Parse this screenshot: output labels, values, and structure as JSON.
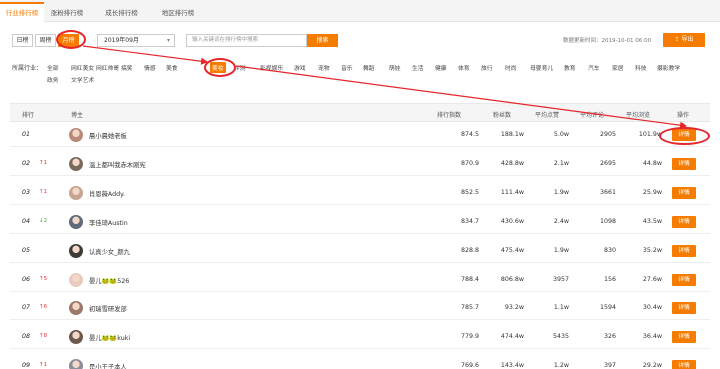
{
  "tabs": [
    {
      "label": "行业排行榜"
    },
    {
      "label": "涨粉排行榜"
    },
    {
      "label": "成长排行榜"
    },
    {
      "label": "地区排行榜"
    }
  ],
  "toolbar": {
    "period_day": "日榜",
    "period_week": "周榜",
    "period_month": "月榜",
    "month_value": "2019年09月",
    "search_placeholder": "输入关键词在排行榜中搜索",
    "search_label": "搜索",
    "update_time": "数据更新时间：2019-10-01 06:00",
    "export_label": "导出"
  },
  "industry": {
    "label": "所属行业：",
    "items": [
      "全部",
      "网红美女",
      "网红帅哥",
      "搞笑",
      "情感",
      "美食",
      "美妆",
      "评测",
      "影视娱乐",
      "游戏",
      "宠物",
      "音乐",
      "舞蹈",
      "萌娃",
      "生活",
      "健康",
      "体育",
      "旅行",
      "时尚",
      "母婴育儿",
      "教育",
      "汽车",
      "家居",
      "科技",
      "摄影教学",
      "政务",
      "文学艺术"
    ],
    "active_index": 6
  },
  "table": {
    "headers": {
      "rank": "排行",
      "name": "博主",
      "index": "排行指数",
      "fans": "粉丝数",
      "avg_likes": "平均点赞",
      "avg_comments": "平均评论",
      "avg_views": "平均浏览",
      "ops": "操作"
    },
    "detail_label": "详情",
    "rows": [
      {
        "rank": "01",
        "trend": "",
        "trend_color": "#999999",
        "name": "晨小晨她老板",
        "index": "874.5",
        "fans": "188.1w",
        "likes": "5.0w",
        "comments": "2905",
        "views": "101.9w",
        "avatar_color": "#b98a7a"
      },
      {
        "rank": "02",
        "trend": "↑1",
        "trend_color": "#e53935",
        "name": "温上都叫我赤木刚宪",
        "index": "870.9",
        "fans": "428.8w",
        "likes": "2.1w",
        "comments": "2695",
        "views": "44.8w",
        "avatar_color": "#7a6a5e"
      },
      {
        "rank": "03",
        "trend": "↑1",
        "trend_color": "#e53935",
        "name": "肖恩薇Addy.",
        "index": "852.5",
        "fans": "111.4w",
        "likes": "1.9w",
        "comments": "3661",
        "views": "25.9w",
        "avatar_color": "#c7a48f"
      },
      {
        "rank": "04",
        "trend": "↓2",
        "trend_color": "#43a047",
        "name": "李佳琦Austin",
        "index": "834.7",
        "fans": "430.6w",
        "likes": "2.4w",
        "comments": "1098",
        "views": "43.5w",
        "avatar_color": "#5d6b7a"
      },
      {
        "rank": "05",
        "trend": "",
        "trend_color": "#999999",
        "name": "认真少女_颜九",
        "index": "828.8",
        "fans": "475.4w",
        "likes": "1.9w",
        "comments": "830",
        "views": "35.2w",
        "avatar_color": "#3f3a36"
      },
      {
        "rank": "06",
        "trend": "↑5",
        "trend_color": "#e53935",
        "name": "晏儿🐸🐸526",
        "index": "788.4",
        "fans": "806.8w",
        "likes": "3957",
        "comments": "156",
        "views": "27.6w",
        "avatar_color": "#e8cbc0"
      },
      {
        "rank": "07",
        "trend": "↑6",
        "trend_color": "#e53935",
        "name": "初瑞雪研发部",
        "index": "785.7",
        "fans": "93.2w",
        "likes": "1.1w",
        "comments": "1594",
        "views": "30.4w",
        "avatar_color": "#9c7b6b"
      },
      {
        "rank": "08",
        "trend": "↑8",
        "trend_color": "#e53935",
        "name": "晏儿🐸🐸kuki",
        "index": "779.9",
        "fans": "474.4w",
        "likes": "5435",
        "comments": "326",
        "views": "36.4w",
        "avatar_color": "#6e5a4d"
      },
      {
        "rank": "09",
        "trend": "↑1",
        "trend_color": "#e53935",
        "name": "是小王子本人",
        "index": "769.6",
        "fans": "143.4w",
        "likes": "1.2w",
        "comments": "397",
        "views": "29.2w",
        "avatar_color": "#8a8f99"
      }
    ]
  },
  "colors": {
    "accent": "#f57c00",
    "annotation": "#e5262a"
  }
}
